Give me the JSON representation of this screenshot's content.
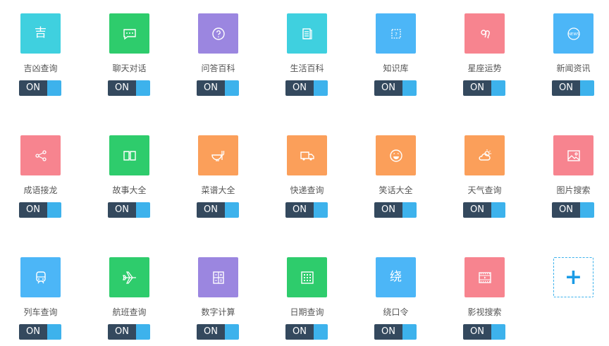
{
  "colors": {
    "cyan": "#3fd0df",
    "green": "#2ecc6c",
    "purple": "#9b86e0",
    "blue": "#4cb6f7",
    "pink": "#f7848f",
    "orange": "#fb9f5a",
    "toggle_dark": "#34495e",
    "toggle_knob": "#3db2ec"
  },
  "toggle_label": "ON",
  "add_button_glyph": "+",
  "plugins": [
    {
      "label": "吉凶查询",
      "icon": "ji-char-icon",
      "glyph": "吉",
      "color": "cyan"
    },
    {
      "label": "聊天对话",
      "icon": "chat-bubble-icon",
      "color": "green"
    },
    {
      "label": "问答百科",
      "icon": "question-bubble-icon",
      "color": "purple"
    },
    {
      "label": "生活百科",
      "icon": "document-icon",
      "color": "cyan"
    },
    {
      "label": "知识库",
      "icon": "knowledge-icon",
      "color": "blue"
    },
    {
      "label": "星座运势",
      "icon": "zodiac-leo-icon",
      "color": "pink"
    },
    {
      "label": "新闻资讯",
      "icon": "news-globe-icon",
      "glyph": "NEWS",
      "color": "blue"
    },
    {
      "label": "成语接龙",
      "icon": "share-icon",
      "color": "pink"
    },
    {
      "label": "故事大全",
      "icon": "book-icon",
      "color": "green"
    },
    {
      "label": "菜谱大全",
      "icon": "dish-icon",
      "color": "orange"
    },
    {
      "label": "快递查询",
      "icon": "truck-icon",
      "color": "orange"
    },
    {
      "label": "笑话大全",
      "icon": "smile-icon",
      "color": "orange"
    },
    {
      "label": "天气查询",
      "icon": "weather-icon",
      "color": "orange"
    },
    {
      "label": "图片搜索",
      "icon": "image-icon",
      "color": "pink"
    },
    {
      "label": "列车查询",
      "icon": "train-icon",
      "color": "blue"
    },
    {
      "label": "航班查询",
      "icon": "airplane-icon",
      "color": "green"
    },
    {
      "label": "数字计算",
      "icon": "calculator-icon",
      "color": "purple"
    },
    {
      "label": "日期查询",
      "icon": "calendar-icon",
      "color": "green"
    },
    {
      "label": "绕口令",
      "icon": "rao-char-icon",
      "glyph": "绕",
      "color": "blue"
    },
    {
      "label": "影视搜索",
      "icon": "film-icon",
      "color": "pink"
    }
  ]
}
